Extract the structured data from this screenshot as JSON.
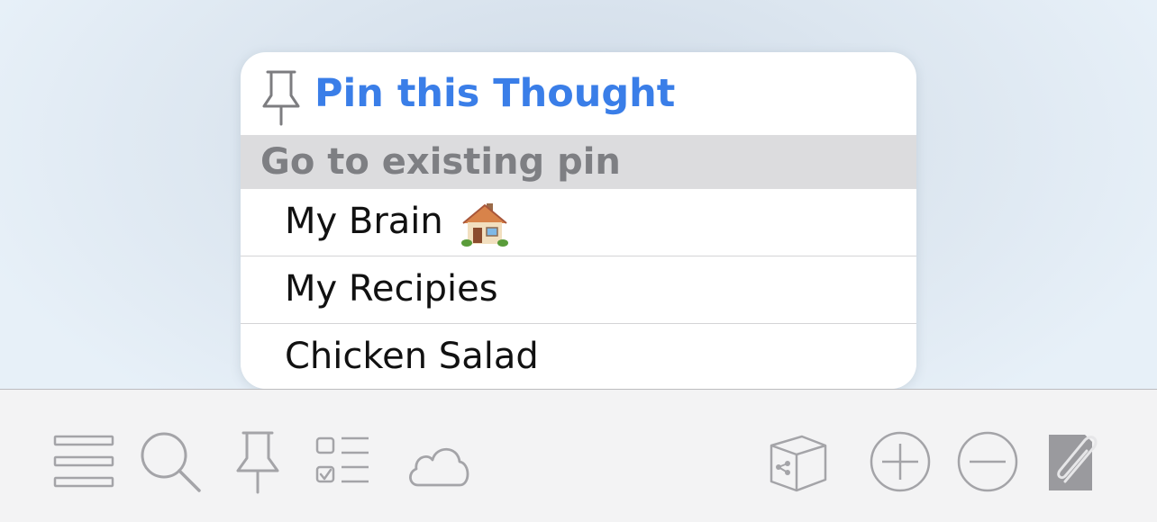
{
  "popup": {
    "pin_action": {
      "label": "Pin this Thought",
      "icon": "pin-icon",
      "color": "#3a7ee8"
    },
    "section_header": "Go to existing pin",
    "pins": [
      {
        "label": "My Brain",
        "icon": "house-emoji"
      },
      {
        "label": "My Recipies"
      },
      {
        "label": "Chicken Salad"
      }
    ]
  },
  "toolbar": {
    "icons": [
      "menu-icon",
      "search-icon",
      "pin-icon",
      "checklist-icon",
      "cloud-icon",
      "thought-box-icon",
      "add-icon",
      "remove-icon",
      "attachment-icon"
    ],
    "icon_color": "#a4a4a8"
  }
}
